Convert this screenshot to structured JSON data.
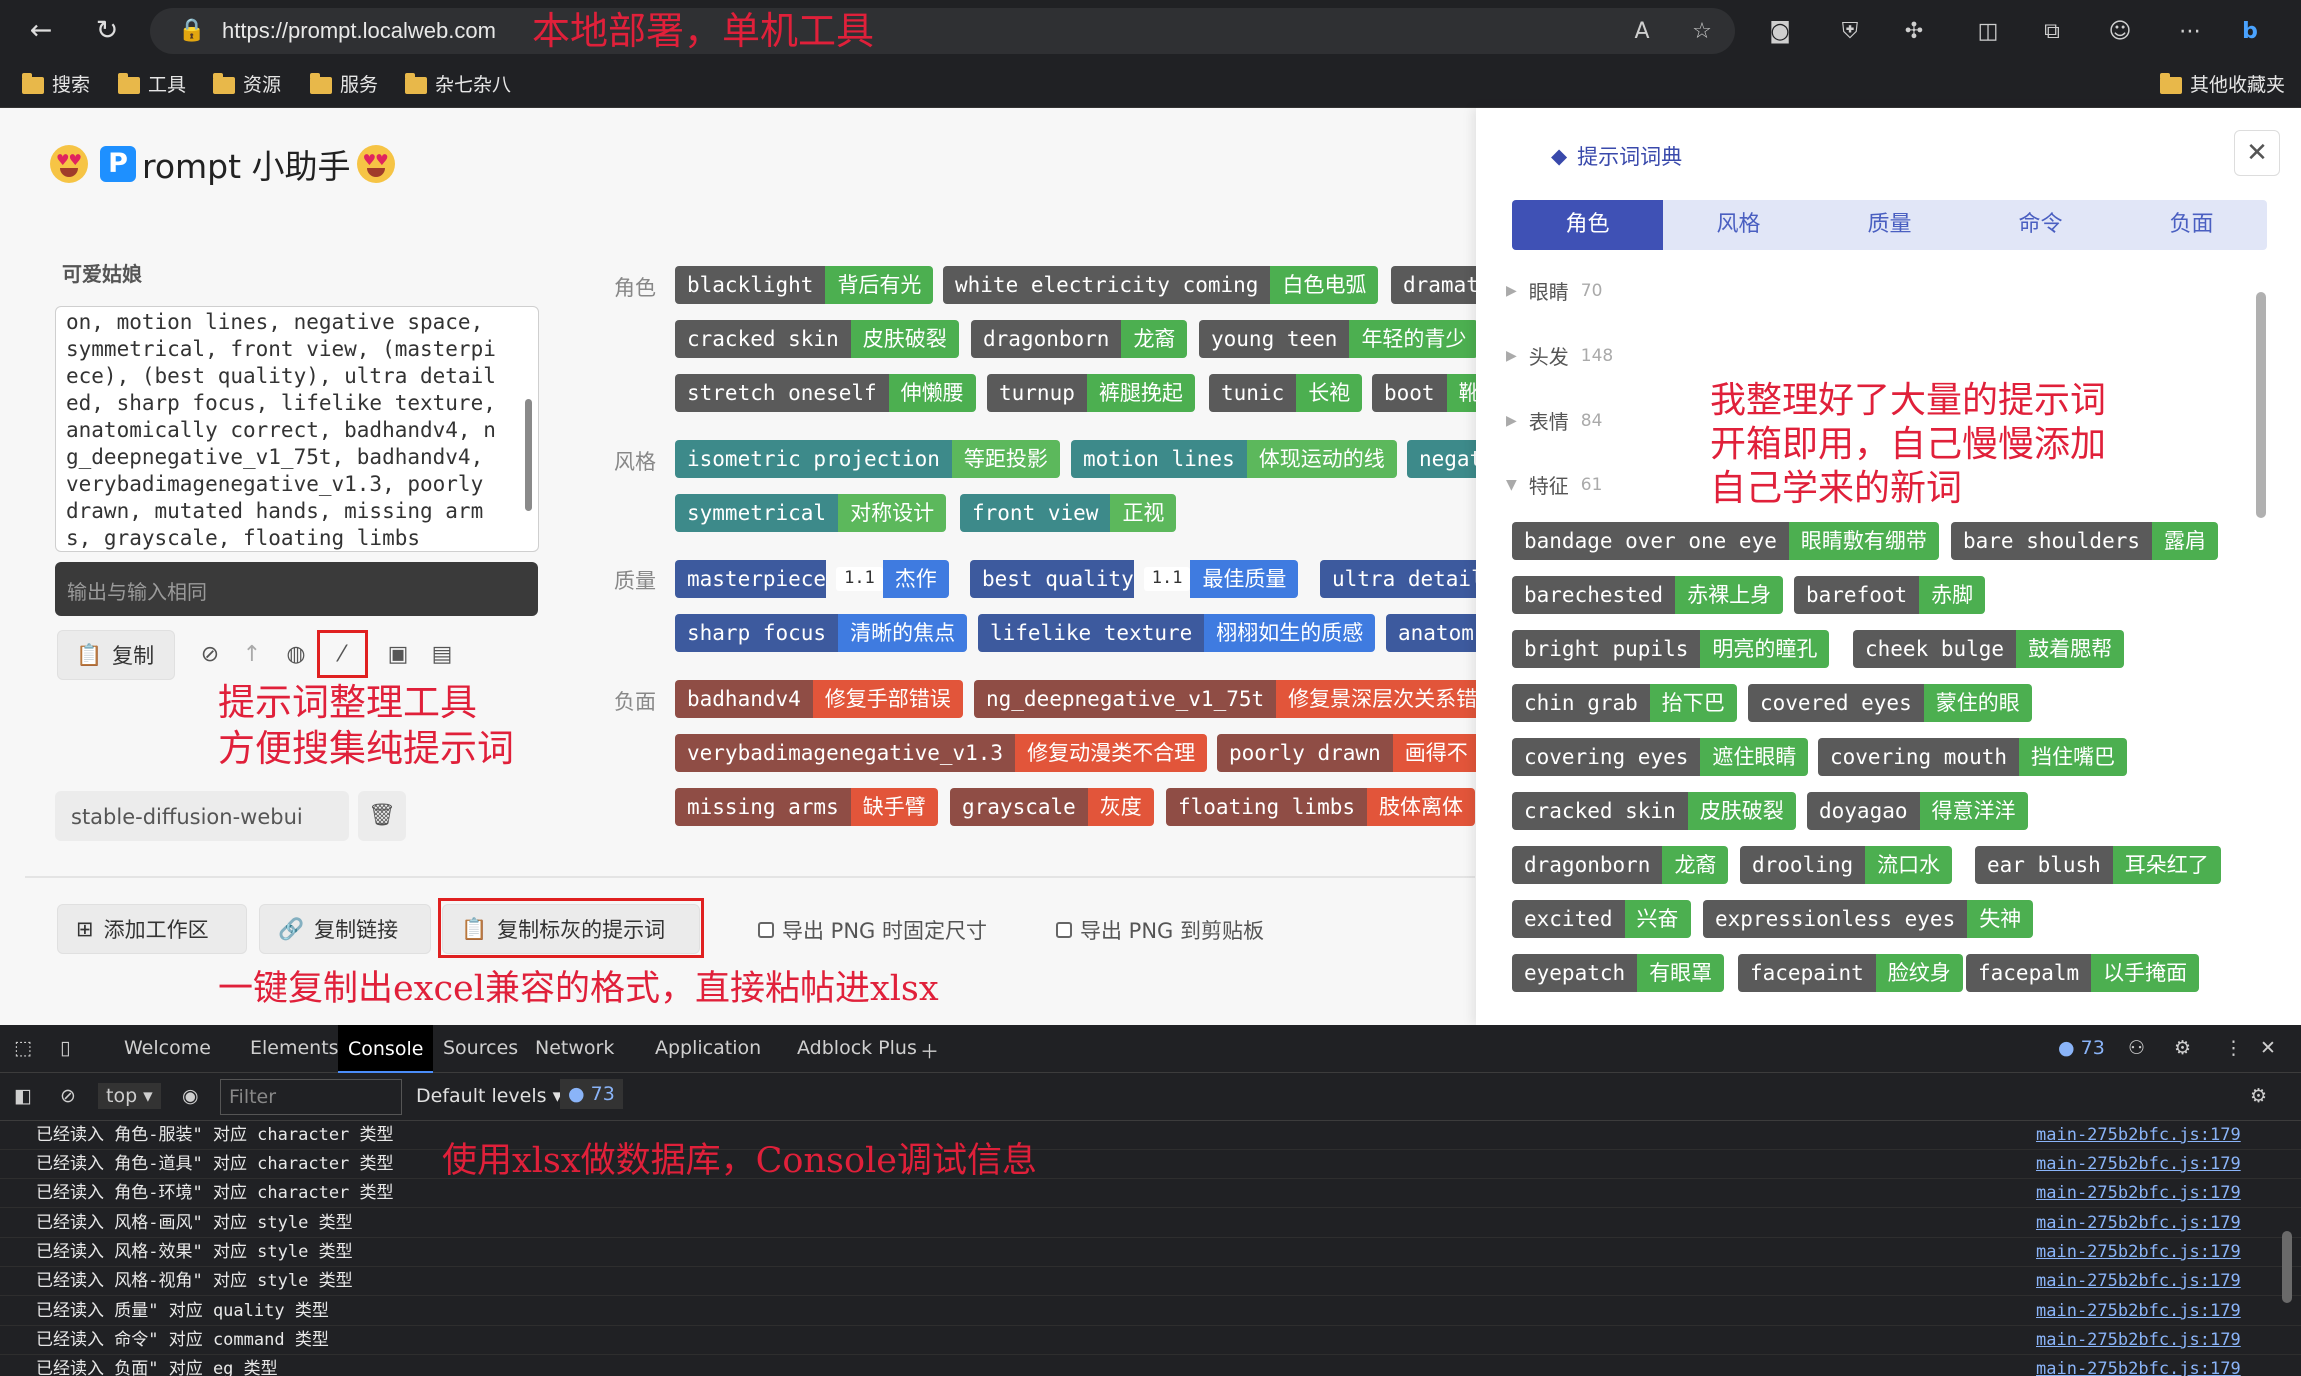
{
  "browser": {
    "url": "https://prompt.localweb.com",
    "bookmarks": [
      "搜索",
      "工具",
      "资源",
      "服务",
      "杂七杂八"
    ],
    "other_bookmarks": "其他收藏夹"
  },
  "app": {
    "title": "rompt 小助手",
    "logo_letter": "P",
    "prompt_name": "可爱姑娘",
    "textarea_text": "on, motion lines, negative space,\nsymmetrical, front view, (masterpi\nece), (best quality), ultra detail\ned, sharp focus, lifelike texture,\nanatomically correct, badhandv4, n\ng_deepnegative_v1_75t, badhandv4,\nverybadimagenegative_v1.3, poorly\ndrawn, mutated hands, missing arm\ns, grayscale, floating limbs",
    "output_placeholder": "输出与输入相同",
    "copy_label": "复制",
    "selector_value": "stable-diffusion-webui",
    "add_workspace": "添加工作区",
    "copy_link": "复制链接",
    "copy_gray": "复制标灰的提示词",
    "export_fixed": "导出 PNG 时固定尺寸",
    "export_clip": "导出 PNG 到剪贴板"
  },
  "annotations": {
    "top": "本地部署，单机工具",
    "tool_line1": "提示词整理工具",
    "tool_line2": "方便搜集纯提示词",
    "excel": "一键复制出excel兼容的格式，直接粘帖进xlsx",
    "panel_line1": "我整理好了大量的提示词",
    "panel_line2": "开箱即用，自己慢慢添加",
    "panel_line3": "自己学来的新词",
    "console": "使用xlsx做数据库，Console调试信息"
  },
  "categories": {
    "role": "角色",
    "style": "风格",
    "quality": "质量",
    "negative": "负面"
  },
  "tags_role": [
    {
      "en": "blacklight",
      "zh": "背后有光"
    },
    {
      "en": "white electricity coming",
      "zh": "白色电弧"
    },
    {
      "en": "dramat",
      "zh": ""
    },
    {
      "en": "cracked skin",
      "zh": "皮肤破裂"
    },
    {
      "en": "dragonborn",
      "zh": "龙裔"
    },
    {
      "en": "young teen",
      "zh": "年轻的青少"
    },
    {
      "en": "stretch oneself",
      "zh": "伸懒腰"
    },
    {
      "en": "turnup",
      "zh": "裤腿挽起"
    },
    {
      "en": "tunic",
      "zh": "长袍"
    },
    {
      "en": "boot",
      "zh": "靴"
    }
  ],
  "tags_style": [
    {
      "en": "isometric projection",
      "zh": "等距投影"
    },
    {
      "en": "motion lines",
      "zh": "体现运动的线"
    },
    {
      "en": "negat",
      "zh": ""
    },
    {
      "en": "symmetrical",
      "zh": "对称设计"
    },
    {
      "en": "front view",
      "zh": "正视"
    }
  ],
  "tags_quality": [
    {
      "en": "masterpiece",
      "w": "1.1",
      "zh": "杰作"
    },
    {
      "en": "best quality",
      "w": "1.1",
      "zh": "最佳质量"
    },
    {
      "en": "ultra detail",
      "zh": ""
    },
    {
      "en": "sharp focus",
      "zh": "清晰的焦点"
    },
    {
      "en": "lifelike texture",
      "zh": "栩栩如生的质感"
    },
    {
      "en": "anatom",
      "zh": ""
    }
  ],
  "tags_negative": [
    {
      "en": "badhandv4",
      "zh": "修复手部错误"
    },
    {
      "en": "ng_deepnegative_v1_75t",
      "zh": "修复景深层次关系错"
    },
    {
      "en": "verybadimagenegative_v1.3",
      "zh": "修复动漫类不合理"
    },
    {
      "en": "poorly drawn",
      "zh": "画得不"
    },
    {
      "en": "missing arms",
      "zh": "缺手臂"
    },
    {
      "en": "grayscale",
      "zh": "灰度"
    },
    {
      "en": "floating limbs",
      "zh": "肢体离体"
    }
  ],
  "panel": {
    "title": "提示词词典",
    "tabs": [
      "角色",
      "风格",
      "质量",
      "命令",
      "负面"
    ],
    "tree": [
      {
        "label": "眼睛",
        "count": "70"
      },
      {
        "label": "头发",
        "count": "148"
      },
      {
        "label": "表情",
        "count": "84"
      },
      {
        "label": "特征",
        "count": "61"
      }
    ],
    "tags": [
      {
        "en": "bandage over one eye",
        "zh": "眼睛敷有绷带"
      },
      {
        "en": "bare shoulders",
        "zh": "露肩"
      },
      {
        "en": "barechested",
        "zh": "赤裸上身"
      },
      {
        "en": "barefoot",
        "zh": "赤脚"
      },
      {
        "en": "bright pupils",
        "zh": "明亮的瞳孔"
      },
      {
        "en": "cheek bulge",
        "zh": "鼓着腮帮"
      },
      {
        "en": "chin grab",
        "zh": "抬下巴"
      },
      {
        "en": "covered eyes",
        "zh": "蒙住的眼"
      },
      {
        "en": "covering eyes",
        "zh": "遮住眼睛"
      },
      {
        "en": "covering mouth",
        "zh": "挡住嘴巴"
      },
      {
        "en": "cracked skin",
        "zh": "皮肤破裂"
      },
      {
        "en": "doyagao",
        "zh": "得意洋洋"
      },
      {
        "en": "dragonborn",
        "zh": "龙裔"
      },
      {
        "en": "drooling",
        "zh": "流口水"
      },
      {
        "en": "ear blush",
        "zh": "耳朵红了"
      },
      {
        "en": "excited",
        "zh": "兴奋"
      },
      {
        "en": "expressionless eyes",
        "zh": "失神"
      },
      {
        "en": "eyepatch",
        "zh": "有眼罩"
      },
      {
        "en": "facepaint",
        "zh": "脸纹身"
      },
      {
        "en": "facepalm",
        "zh": "以手掩面"
      }
    ]
  },
  "devtools": {
    "tabs": [
      "Welcome",
      "Elements",
      "Console",
      "Sources",
      "Network",
      "Application",
      "Adblock Plus"
    ],
    "context": "top",
    "filter_placeholder": "Filter",
    "levels": "Default levels",
    "count": "73",
    "logs": [
      "已经读入 角色-服装\" 对应 character 类型",
      "已经读入 角色-道具\" 对应 character 类型",
      "已经读入 角色-环境\" 对应 character 类型",
      "已经读入 风格-画风\" 对应 style 类型",
      "已经读入 风格-效果\" 对应 style 类型",
      "已经读入 风格-视角\" 对应 style 类型",
      "已经读入 质量\" 对应 quality 类型",
      "已经读入 命令\" 对应 command 类型",
      "已经读入 负面\" 对应 eg 类型"
    ],
    "source": "main-275b2bfc.js:179"
  }
}
